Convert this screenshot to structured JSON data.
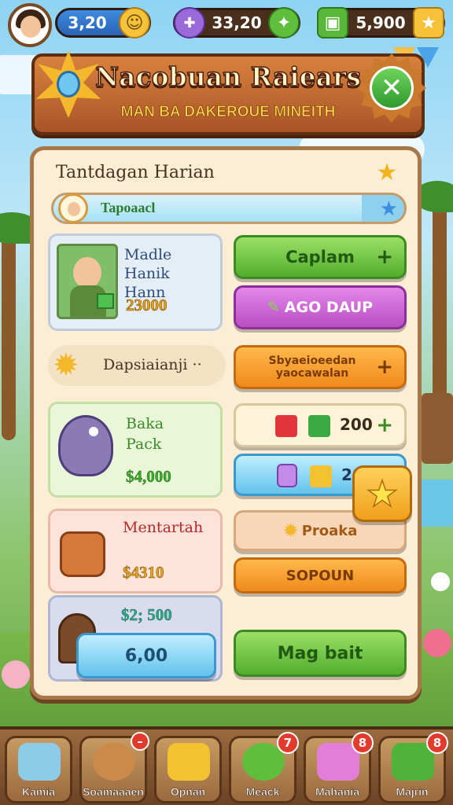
{
  "topbar": {
    "coins": "3,20",
    "gems": "33,20",
    "cash": "5,900"
  },
  "banner": {
    "title": "Nacobuan Raiears",
    "subtitle": "MAN BA DAKEROUE MINEITH"
  },
  "panel": {
    "title": "Tantdagan Harian",
    "progress_label": "Tapoaacl",
    "progress_fraction": 0.88
  },
  "offers": {
    "offer1": {
      "title_line1": "Madle Hanik",
      "title_line2": "Hann",
      "price": "23000"
    },
    "claim_button": "Caplam",
    "purple_button": "AGO DAUP",
    "section_label": "Dapsiaianji ··",
    "orange_button": "Sbyaeioeedan yaocawalan",
    "offer2": {
      "title_line1": "Baka",
      "title_line2": "Pack",
      "price": "$4,000"
    },
    "reward_row1_value": "200",
    "reward_row2_value": "200",
    "offer3": {
      "title": "Mentartah",
      "price": "$4310"
    },
    "proaka_button": "Proaka",
    "sopoun_button": "SOPOUN",
    "offer4": {
      "price_top": "$2; 500",
      "price_button": "6,00"
    },
    "big_button": "Mag bait"
  },
  "nav": [
    {
      "label": "Kamia",
      "badge": ""
    },
    {
      "label": "Soamaaaen",
      "badge": ""
    },
    {
      "label": "Opnan",
      "badge": ""
    },
    {
      "label": "Meack",
      "badge": "7"
    },
    {
      "label": "Mahania",
      "badge": "8"
    },
    {
      "label": "Majrin",
      "badge": "8"
    }
  ],
  "colors": {
    "panel_bg": "#fbeed5",
    "banner": "#c96a2f",
    "accent_green": "#52ad2e",
    "accent_orange": "#f08a1c",
    "accent_purple": "#b94ec3"
  }
}
